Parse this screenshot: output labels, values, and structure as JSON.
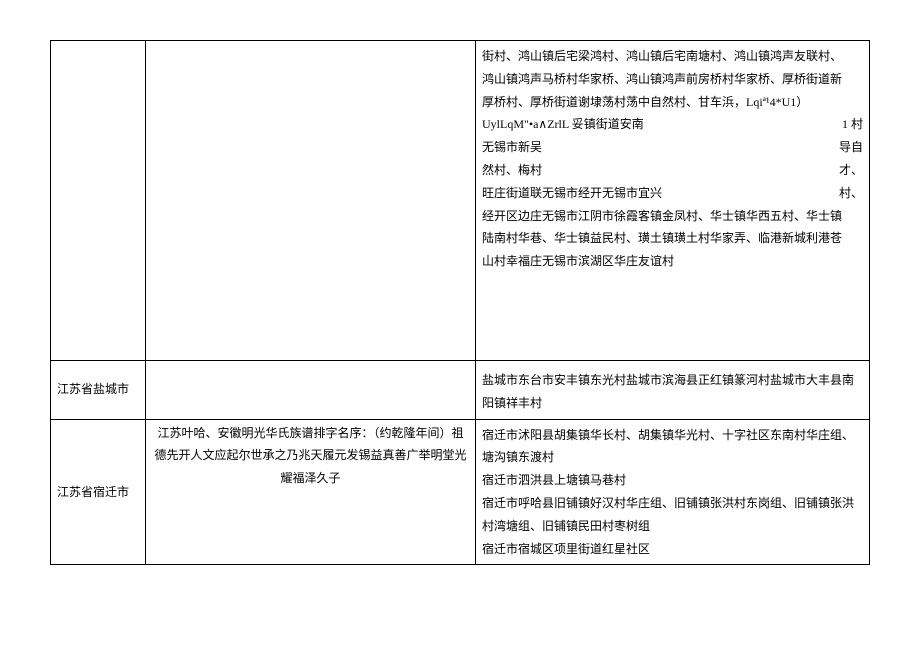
{
  "rows": [
    {
      "col1": "",
      "col2": "",
      "col3_lines": [
        {
          "left": "街村、鸿山镇后宅梁鸿村、鸿山镇后宅南塘村、鸿山镇鸿声友联村、",
          "right": ""
        },
        {
          "left": "鸿山镇鸿声马桥村华家桥、鸿山镇鸿声前房桥村华家桥、厚桥街道新",
          "right": ""
        },
        {
          "left": "厚桥村、厚桥街道谢埭荡村荡中自然村、甘车浜，Lqiª¹4*U1）",
          "right": ""
        },
        {
          "left": "UylLqM\"•a∧ZrlL 妥镇街道安南",
          "right": "1 村"
        },
        {
          "left": "无锡市新吴",
          "right": "导自"
        },
        {
          "left": "然村、梅村",
          "right": "才、"
        },
        {
          "left": "旺庄街道联无锡市经开无锡市宜兴",
          "right": "村、"
        },
        {
          "left": "经开区边庄无锡市江阴市徐霞客镇金凤村、华士镇华西五村、华士镇",
          "right": ""
        },
        {
          "left": "陆南村华巷、华士镇益民村、璜土镇璜土村华家弄、临港新城利港苍",
          "right": ""
        },
        {
          "left": "山村幸福庄无锡市滨湖区华庄友谊村",
          "right": ""
        }
      ]
    },
    {
      "col1": "江苏省盐城市",
      "col2": "",
      "col3_text": "盐城市东台市安丰镇东光村盐城市滨海县正红镇篆河村盐城市大丰县南阳镇祥丰村"
    },
    {
      "col1": "江苏省宿迁市",
      "col2": "江苏叶哈、安徽明光华氏族谱排字名序：（约乾隆年间）祖德先开人文应起尔世承之乃兆天履元发锡益真善广举明堂光耀福泽久子",
      "col3_lines_plain": [
        "宿迁市沭阳县胡集镇华长村、胡集镇华光村、十字社区东南村华庄组、塘沟镇东渡村",
        "宿迁市泗洪县上塘镇马巷村",
        "宿迁市呼哈县旧铺镇好汉村华庄组、旧铺镇张洪村东岗组、旧铺镇张洪村湾塘组、旧铺镇民田村枣树组",
        "宿迁市宿城区项里街道红星社区"
      ]
    }
  ]
}
